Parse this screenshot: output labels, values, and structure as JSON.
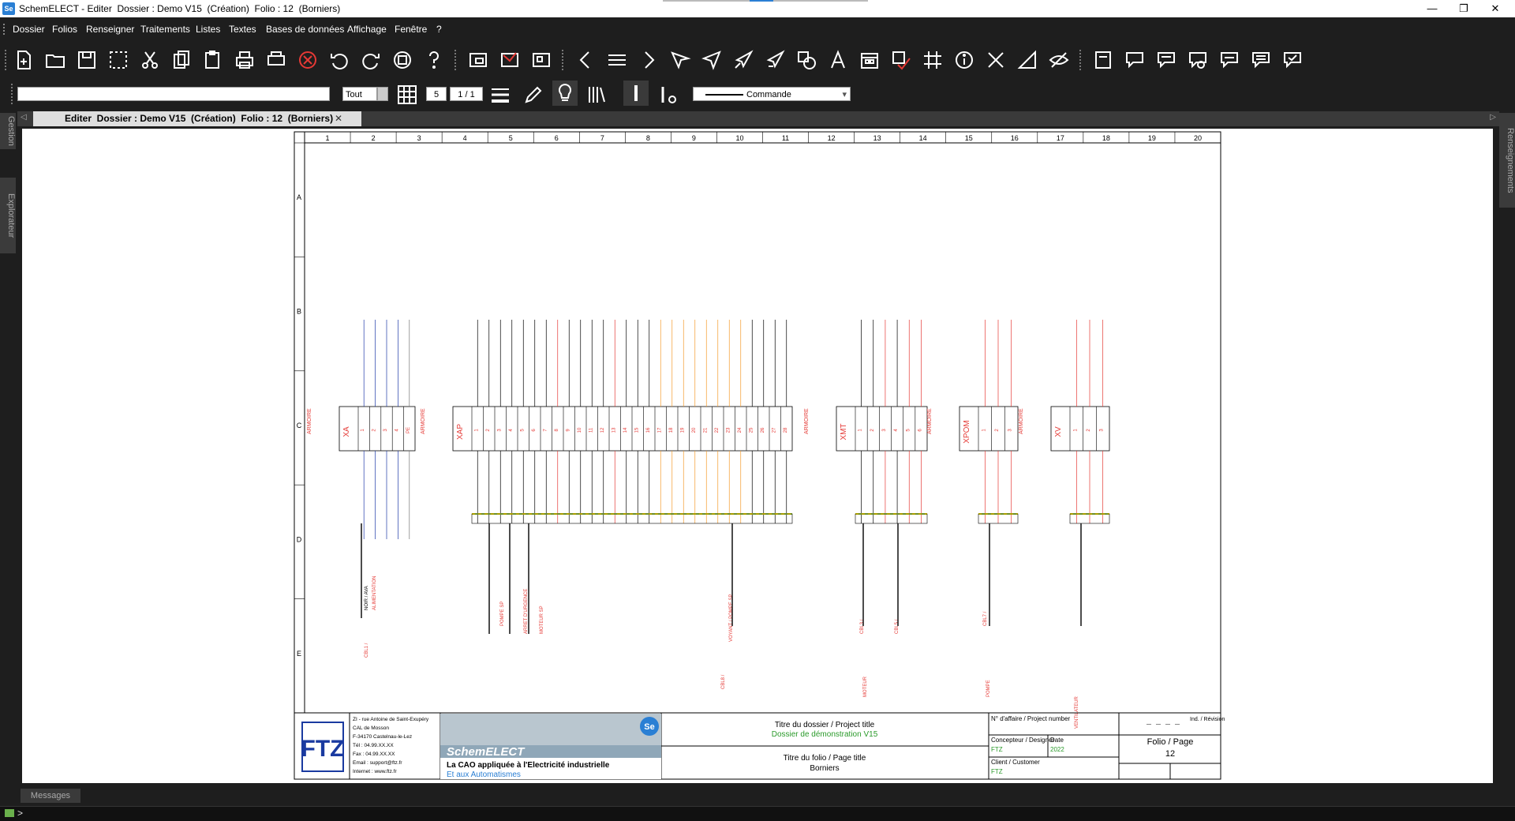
{
  "window": {
    "title": "SchemELECT - Editer  Dossier : Demo V15  (Création)  Folio : 12  (Borniers)",
    "app_icon": "Se",
    "minimize": "—",
    "maximize": "❐",
    "close": "✕"
  },
  "menu": [
    "Dossier",
    "Folios",
    "Renseigner",
    "Traitements",
    "Listes",
    "Textes",
    "Bases de données",
    "Affichage",
    "Fenêtre",
    "?"
  ],
  "toolbar1": [
    "new-file-icon",
    "open-folder-icon",
    "save-icon",
    "select-icon",
    "cut-icon",
    "copy-icon",
    "paste-icon",
    "print-icon",
    "pdf-icon",
    "cancel-icon",
    "undo-icon",
    "redo-icon",
    "stop-icon",
    "help-icon",
    "window-icon",
    "mail-icon",
    "export-icon",
    "prev-icon",
    "menu-icon",
    "next-icon",
    "cursor-icon",
    "arrow-icon",
    "plane-icon",
    "plane2-icon",
    "shapes-icon",
    "text-icon",
    "calendar-icon",
    "check-icon",
    "grid-hash-icon",
    "info-icon",
    "cross-icon",
    "ruler-icon",
    "hide-icon",
    "panel-icon",
    "comment-add-icon",
    "comment-edit-icon",
    "comment-gear-icon",
    "comment-delete-icon",
    "comment-list-icon",
    "comment-check-icon"
  ],
  "toolbar2": {
    "filter_value": "Tout",
    "page_value": "5",
    "page_count": "1 / 1",
    "line_type": "Commande"
  },
  "tab": {
    "label": "Editer  Dossier : Demo V15  (Création)  Folio : 12  (Borniers)",
    "close": "✕"
  },
  "side_left": [
    "Gestion",
    "Explorateur"
  ],
  "side_right": [
    "Renseignements"
  ],
  "sheet": {
    "columns": [
      "1",
      "2",
      "3",
      "4",
      "5",
      "6",
      "7",
      "8",
      "9",
      "10",
      "11",
      "12",
      "13",
      "14",
      "15",
      "16",
      "17",
      "18",
      "19",
      "20"
    ],
    "rows": [
      "A",
      "B",
      "C",
      "D",
      "E"
    ],
    "strips": [
      {
        "id": "XA",
        "bornes": [
          "1",
          "2",
          "3",
          "4",
          "PE"
        ]
      },
      {
        "id": "XAP",
        "bornes": [
          "1",
          "2",
          "3",
          "4",
          "5",
          "6",
          "7",
          "8",
          "9",
          "10",
          "11",
          "12",
          "13",
          "14",
          "15",
          "16",
          "17",
          "18",
          "19",
          "20",
          "21",
          "22",
          "23",
          "24",
          "25",
          "26",
          "27",
          "28"
        ]
      },
      {
        "id": "XMT",
        "bornes": [
          "1",
          "2",
          "3",
          "4",
          "5",
          "6"
        ]
      },
      {
        "id": "XPOM",
        "bornes": [
          "1",
          "2",
          "3"
        ]
      },
      {
        "id": "XV",
        "bornes": [
          "1",
          "2",
          "3"
        ]
      }
    ],
    "armoire_label": "ARMOIRE",
    "cable_labels": [
      "NOIR / AVA",
      "ALIMENTATION",
      "CBL1 /",
      "POMPE SP",
      "ARRET D'URGENCE",
      "MOTEUR SP",
      "VOYANT / POMPE SP",
      "CBL8 /",
      "CBL3 /",
      "CBL5 /",
      "CBL7 /",
      "MOTEUR",
      "POMPE",
      "VENTILATEUR"
    ],
    "cartouche": {
      "company_lines": [
        "ZI - rue Antoine de Saint-Exupéry",
        "CAL de Mosson",
        "F-34170 Castelnau-le-Lez",
        "Tél : 04.99.XX.XX",
        "Fax : 04.99.XX.XX",
        "Email : support@ftz.fr",
        "Internet : www.ftz.fr"
      ],
      "logo": "FTZ",
      "banner_brand": "SchemELECT",
      "banner_line1": "La CAO appliquée à l'Electricité industrielle",
      "banner_line2": "Et aux Automatismes",
      "project_title_label": "Titre du dossier / Project title",
      "project_title": "Dossier de démonstration V15",
      "folio_title_label": "Titre du folio / Page title",
      "folio_title": "Borniers",
      "affaire_label": "N° d'affaire / Project number",
      "concepteur_label": "Concepteur / Designer",
      "concepteur": "FTZ",
      "date_label": "Date",
      "date": "2022",
      "client_label": "Client / Customer",
      "client": "FTZ",
      "revision_label": "Ind. / Révision",
      "folio_page_label": "Folio / Page",
      "folio_page": "12",
      "dash": "_ _ _ _"
    }
  },
  "status": {
    "messages": "Messages",
    "prompt": ">"
  }
}
